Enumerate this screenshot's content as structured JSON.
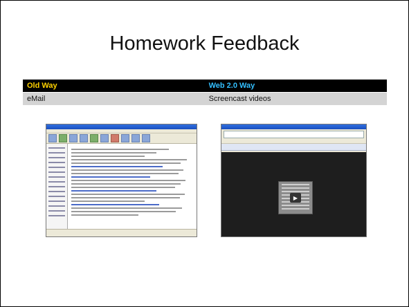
{
  "slide": {
    "title": "Homework Feedback"
  },
  "comparison": {
    "headers": [
      "Old Way",
      "Web 2.0 Way"
    ],
    "row": [
      "eMail",
      "Screencast videos"
    ],
    "header_old_color": "#ffd200",
    "header_new_color": "#33bfff"
  },
  "screenshots": [
    {
      "name": "email-client-window"
    },
    {
      "name": "browser-screencast-window"
    }
  ],
  "icons": {
    "play": "play-icon"
  }
}
